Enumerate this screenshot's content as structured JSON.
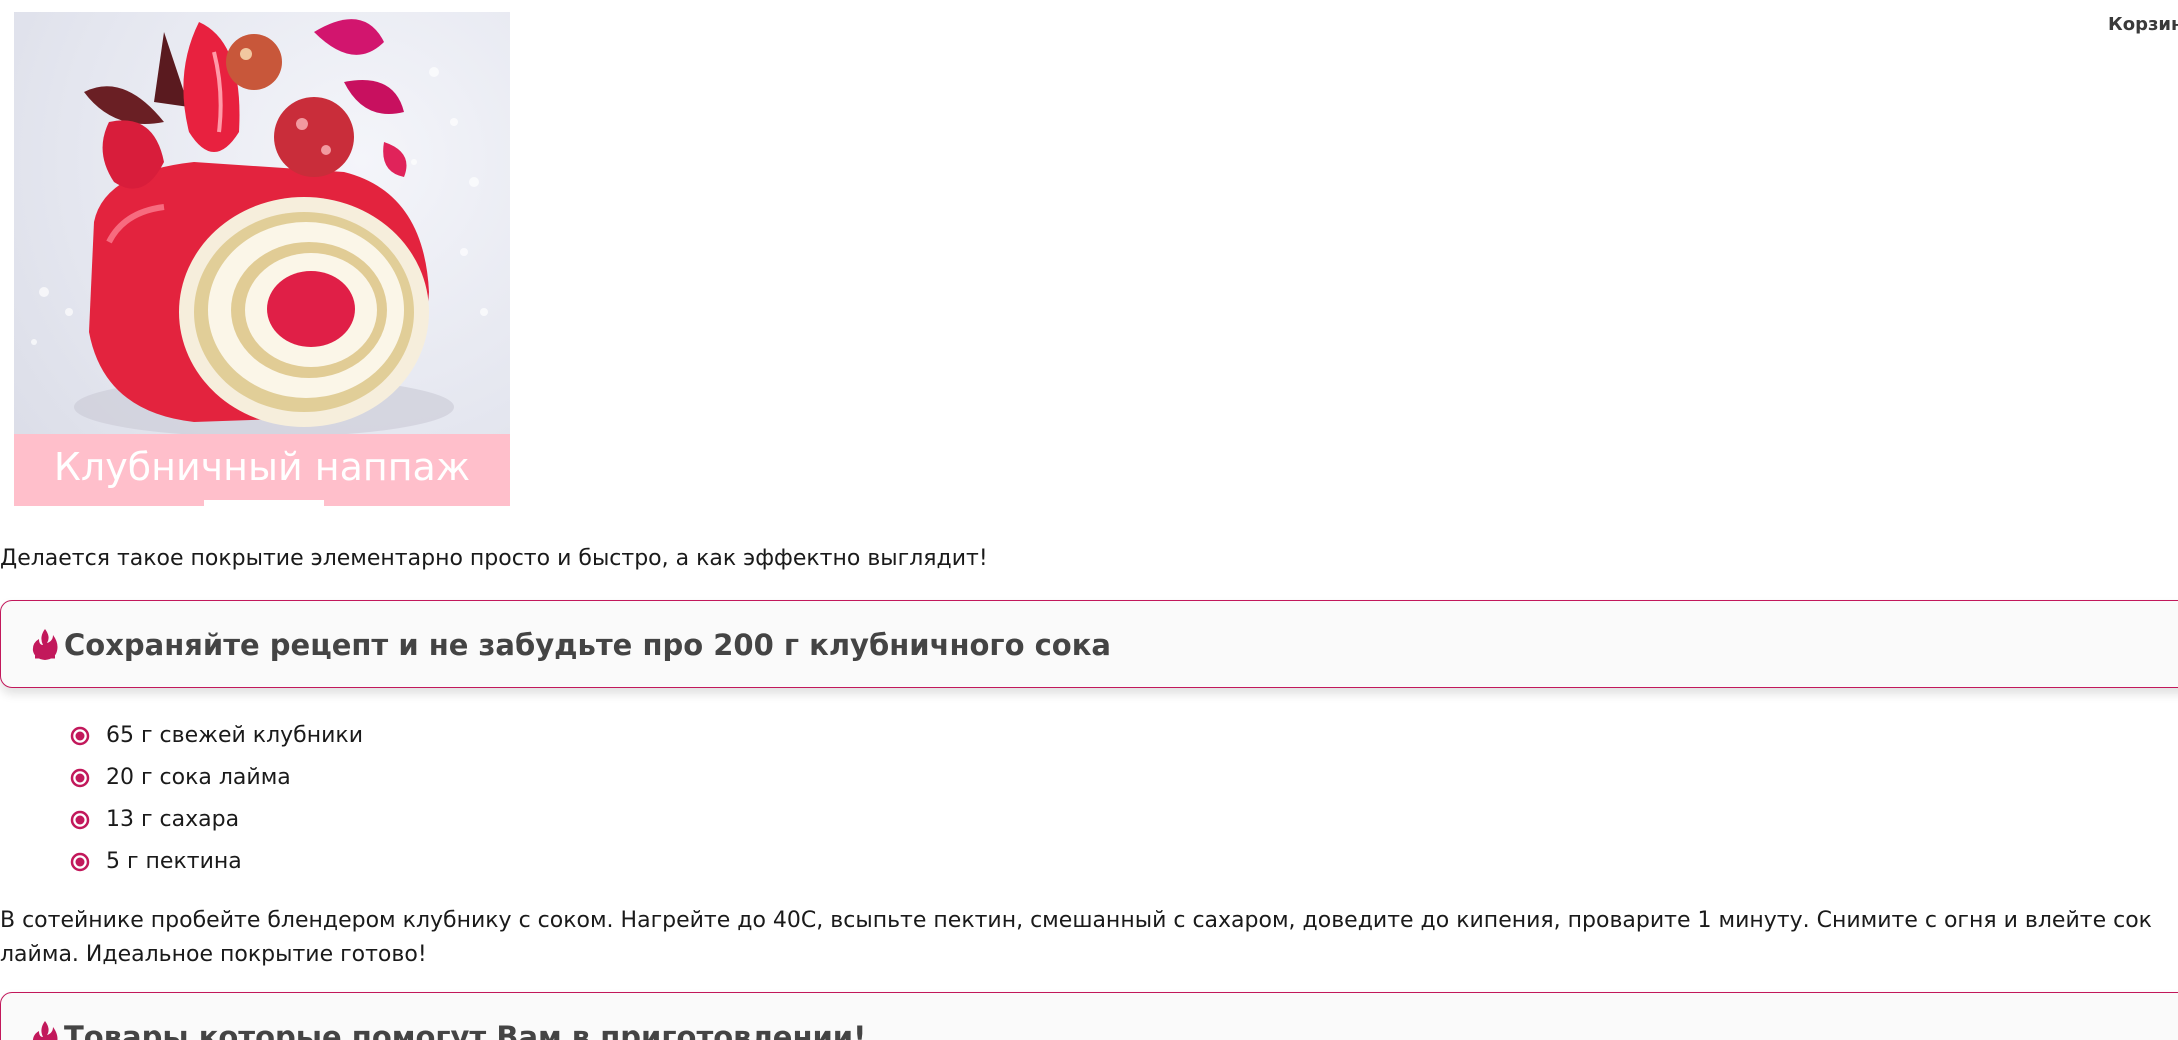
{
  "header": {
    "cart_label": "Корзина"
  },
  "recipe_image": {
    "caption": "Клубничный наппаж"
  },
  "intro_text": "Делается такое покрытие элементарно просто и быстро, а как эффектно выглядит!",
  "save_callout": {
    "text": "Сохраняйте рецепт и не забудьте про 200 г клубничного сока",
    "icon": "flame-icon"
  },
  "ingredients": [
    "65 г свежей клубники",
    "20 г сока лайма",
    "13 г сахара",
    "5 г пектина"
  ],
  "instructions": "В сотейнике пробейте блендером клубнику с соком. Нагрейте до 40С, всыпьте пектин, смешанный с сахаром, доведите до кипения, проварите 1 минуту. Снимите с огня и влейте сок лайма. Идеальное покрытие готово!",
  "products_callout": {
    "text": "Товары которые помогут Вам в приготовлении!",
    "icon": "flame-icon"
  },
  "colors": {
    "accent": "#c2185b",
    "caption_bg": "#ffbfcb",
    "heading": "#444444"
  }
}
